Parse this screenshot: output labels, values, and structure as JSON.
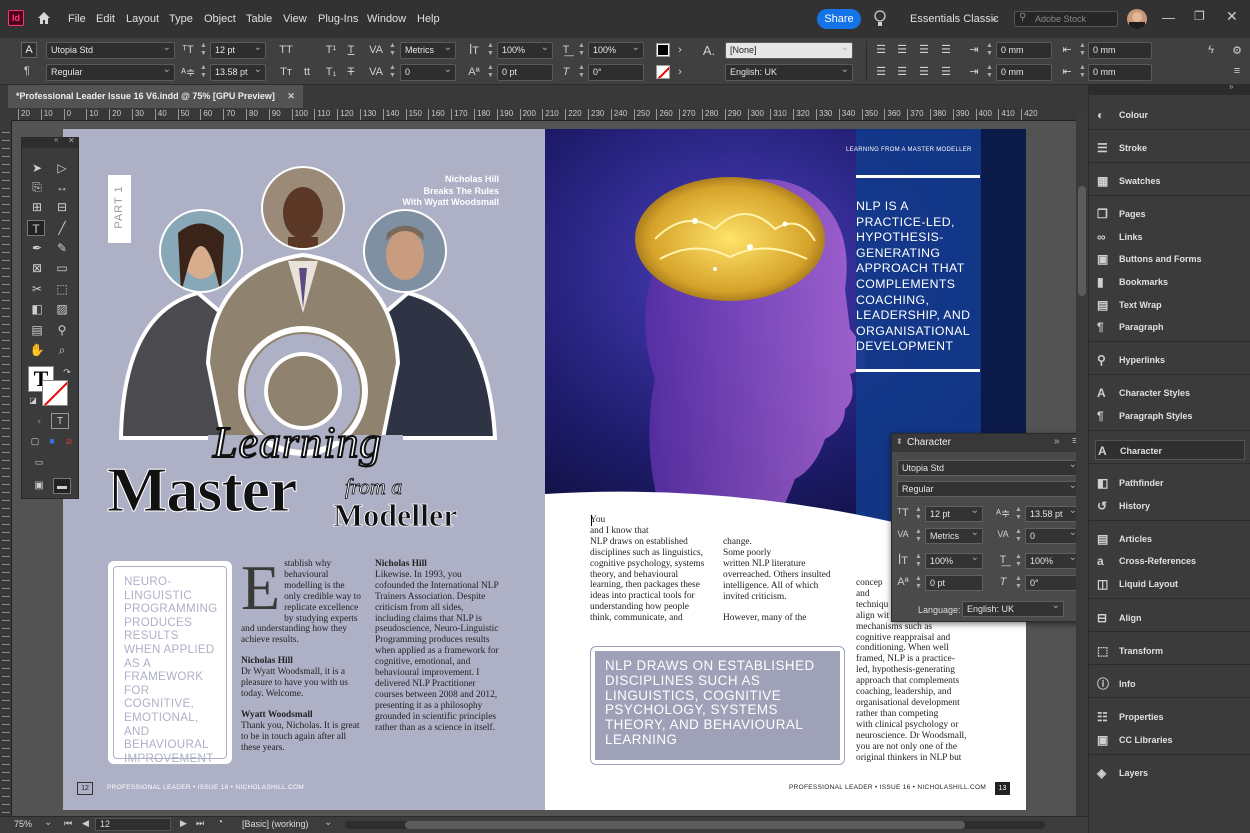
{
  "menubar": {
    "app_icon": "Id",
    "items": [
      "File",
      "Edit",
      "Layout",
      "Type",
      "Object",
      "Table",
      "View",
      "Plug-Ins",
      "Window",
      "Help"
    ],
    "share_label": "Share",
    "workspace": "Essentials Classic",
    "search_placeholder": "Adobe Stock"
  },
  "control": {
    "font_family": "Utopia Std",
    "font_style": "Regular",
    "font_size": "12 pt",
    "leading": "13.58 pt",
    "kerning": "Metrics",
    "tracking": "0",
    "vscale": "100%",
    "hscale": "100%",
    "baseline": "0 pt",
    "skew": "0°",
    "char_style": "[None]",
    "language": "English: UK",
    "indent_left": "0 mm",
    "indent_right": "0 mm",
    "indent_first": "0 mm",
    "indent_last": "0 mm"
  },
  "document_tab": "*Professional Leader Issue 16 V6.indd @ 75% [GPU Preview]",
  "ruler_ticks": [
    "20",
    "10",
    "0",
    "10",
    "20",
    "30",
    "40",
    "50",
    "60",
    "70",
    "80",
    "90",
    "100",
    "110",
    "120",
    "130",
    "140",
    "150",
    "160",
    "170",
    "180",
    "190",
    "200",
    "210",
    "220",
    "230",
    "240",
    "250",
    "260",
    "270",
    "280",
    "290",
    "300",
    "310",
    "320",
    "330",
    "340",
    "350",
    "360",
    "370",
    "380",
    "390",
    "400",
    "410",
    "420"
  ],
  "left_page": {
    "part_label": "PART 1",
    "subtitle_lines": [
      "Nicholas Hill",
      "Breaks The Rules",
      "With Wyatt Woodsmall"
    ],
    "title_word1": "Learning",
    "title_word2": "Master",
    "title_word3": "from a",
    "title_word4": "Modeller",
    "pullquote": "NEURO-LINGUISTIC PROGRAMMING PRODUCES RESULTS WHEN APPLIED AS A FRAMEWORK FOR COGNITIVE, EMOTIONAL, AND BEHAVIOURAL IMPROVEMENT",
    "dropcap": "E",
    "col1_intro": "stablish why behavioural modelling is the only credible way to replicate excellence by studying experts and understanding how they achieve results.",
    "col1_speaker1": "Nicholas Hill",
    "col1_text1": "Dr Wyatt Woodsmall, it is a pleasure to have you with us today. Welcome.",
    "col1_speaker2": "Wyatt Woodsmall",
    "col1_text2": "Thank you, Nicholas. It is great to be in touch again after all these years.",
    "col2_speaker": "Nicholas Hill",
    "col2_text": "Likewise. In 1993, you cofounded the International NLP Trainers Association. Despite criticism from all sides, including claims that NLP is pseudoscience, Neuro-Linguistic Programming produces results when applied as a framework for cognitive, emotional, and behavioural improvement. I delivered NLP Practitioner courses between 2008 and 2012, presenting it as a philosophy grounded in scientific principles rather than as a science in itself.",
    "folio_number": "12",
    "folio_text": "PROFESSIONAL LEADER • ISSUE 16 • NICHOLASHILL.COM"
  },
  "right_page": {
    "kicker": "LEARNING FROM A MASTER MODELLER",
    "callout": "NLP IS A PRACTICE-LED, HYPOTHESIS-GENERATING APPROACH THAT COMPLEMENTS COACHING, LEADERSHIP, AND ORGANISATIONAL DEVELOPMENT",
    "col1_text": "You\nand I know that\nNLP draws on established disciplines such as linguistics, cognitive psychology, systems theory, and behavioural learning, then packages these ideas into practical tools for understanding how people think, communicate, and",
    "col2_text": "change.\nSome poorly\nwritten NLP literature overreached. Others insulted intelligence. All of which invited criticism.\n\nHowever, many of the",
    "col3_lines": [
      "concep",
      "and",
      "techniqu",
      "align wit",
      "mechanisms such as",
      "cognitive reappraisal and",
      "conditioning. When well",
      "framed, NLP is a practice-",
      "led, hypothesis-generating",
      "approach that complements",
      "coaching, leadership, and",
      "organisational development",
      "rather than competing",
      "with clinical psychology or",
      "neuroscience. Dr Woodsmall,",
      "you are not only one of the",
      "original thinkers in NLP but"
    ],
    "pullquote": "NLP DRAWS ON ESTABLISHED DISCIPLINES SUCH AS LINGUISTICS, COGNITIVE PSYCHOLOGY, SYSTEMS THEORY, AND BEHAVIOURAL LEARNING",
    "folio_text": "PROFESSIONAL LEADER • ISSUE 16 • NICHOLASHILL.COM",
    "folio_number": "13"
  },
  "status": {
    "zoom": "75%",
    "page": "12",
    "style": "[Basic] (working)"
  },
  "character_panel": {
    "title": "Character",
    "font_family": "Utopia Std",
    "font_style": "Regular",
    "size": "12 pt",
    "leading": "13.58 pt",
    "kerning": "Metrics",
    "tracking": "0",
    "vscale": "100%",
    "hscale": "100%",
    "baseline": "0 pt",
    "skew": "0°",
    "language_label": "Language:",
    "language": "English: UK"
  },
  "panels": [
    {
      "label": "Colour",
      "icon": "colour-icon",
      "glyph": "◐"
    },
    {
      "label": "Stroke",
      "icon": "stroke-icon",
      "glyph": "☰"
    },
    {
      "label": "Swatches",
      "icon": "swatches-icon",
      "glyph": "▦"
    },
    {
      "label": "Pages",
      "icon": "pages-icon",
      "glyph": "❐"
    },
    {
      "label": "Links",
      "icon": "links-icon",
      "glyph": "∞"
    },
    {
      "label": "Buttons and Forms",
      "icon": "buttons-icon",
      "glyph": "▣"
    },
    {
      "label": "Bookmarks",
      "icon": "bookmarks-icon",
      "glyph": "▮"
    },
    {
      "label": "Text Wrap",
      "icon": "text-wrap-icon",
      "glyph": "▤"
    },
    {
      "label": "Paragraph",
      "icon": "paragraph-icon",
      "glyph": "¶"
    },
    {
      "label": "Hyperlinks",
      "icon": "hyperlinks-icon",
      "glyph": "⚲"
    },
    {
      "label": "Character Styles",
      "icon": "character-styles-icon",
      "glyph": "A"
    },
    {
      "label": "Paragraph Styles",
      "icon": "paragraph-styles-icon",
      "glyph": "¶"
    },
    {
      "label": "Character",
      "icon": "character-icon",
      "glyph": "A"
    },
    {
      "label": "Pathfinder",
      "icon": "pathfinder-icon",
      "glyph": "◧"
    },
    {
      "label": "History",
      "icon": "history-icon",
      "glyph": "↺"
    },
    {
      "label": "Articles",
      "icon": "articles-icon",
      "glyph": "▤"
    },
    {
      "label": "Cross-References",
      "icon": "cross-references-icon",
      "glyph": "a"
    },
    {
      "label": "Liquid Layout",
      "icon": "liquid-layout-icon",
      "glyph": "◫"
    },
    {
      "label": "Align",
      "icon": "align-icon",
      "glyph": "⊟"
    },
    {
      "label": "Transform",
      "icon": "transform-icon",
      "glyph": "⬚"
    },
    {
      "label": "Info",
      "icon": "info-icon",
      "glyph": "ⓘ"
    },
    {
      "label": "Properties",
      "icon": "properties-icon",
      "glyph": "☷"
    },
    {
      "label": "CC Libraries",
      "icon": "cc-libraries-icon",
      "glyph": "▣"
    },
    {
      "label": "Layers",
      "icon": "layers-icon",
      "glyph": "◈"
    }
  ],
  "colors": {
    "accent": "#1473e6",
    "page_left": "#aeb0c6",
    "callout_blue": "#123a8a",
    "pullquote_box": "#9ea1b8"
  }
}
